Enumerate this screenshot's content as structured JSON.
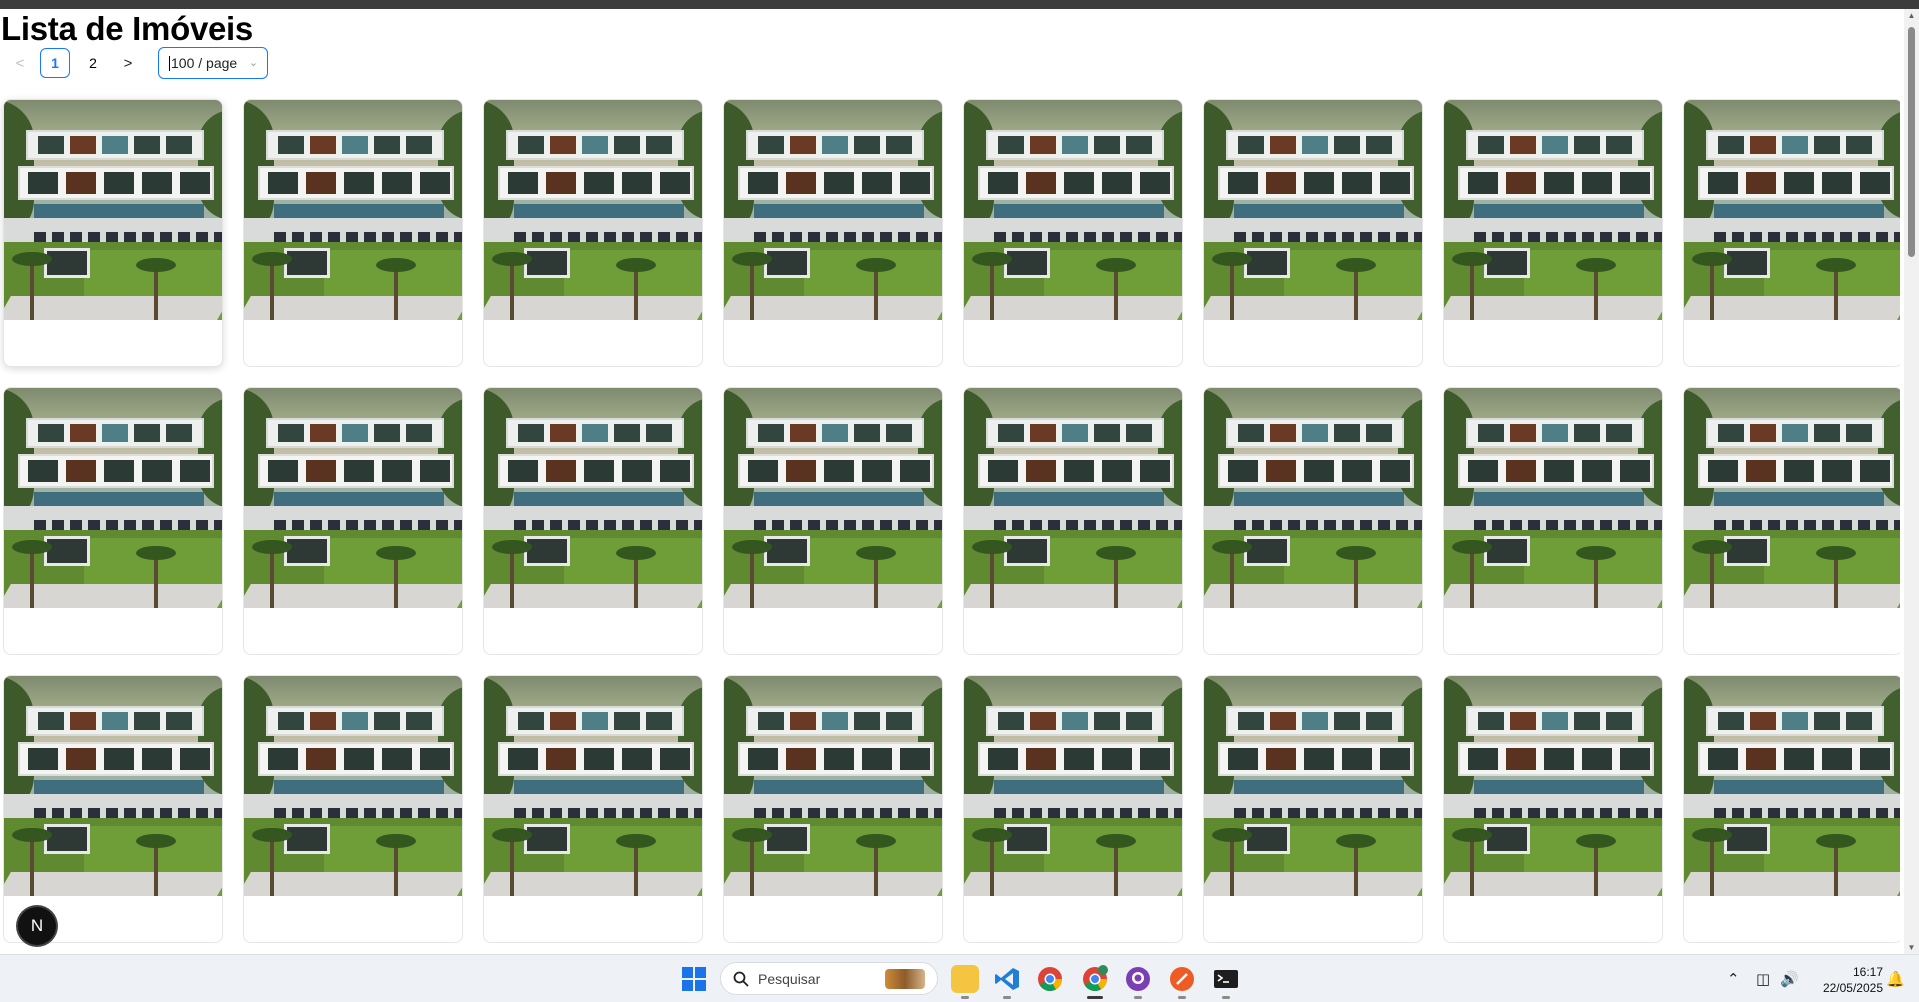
{
  "page": {
    "title": "Lista de Imóveis"
  },
  "pagination": {
    "prev_icon": "chevron-left-icon",
    "next_icon": "chevron-right-icon",
    "prev_label": "<",
    "next_label": ">",
    "pages": [
      "1",
      "2"
    ],
    "current_page": "1",
    "page_size": "100 / page"
  },
  "grid": {
    "rows_visible": 3,
    "columns": 8,
    "card_image": "luxury-house-photo",
    "cards": [
      {
        "id": 1
      },
      {
        "id": 2
      },
      {
        "id": 3
      },
      {
        "id": 4
      },
      {
        "id": 5
      },
      {
        "id": 6
      },
      {
        "id": 7
      },
      {
        "id": 8
      },
      {
        "id": 9
      },
      {
        "id": 10
      },
      {
        "id": 11
      },
      {
        "id": 12
      },
      {
        "id": 13
      },
      {
        "id": 14
      },
      {
        "id": 15
      },
      {
        "id": 16
      },
      {
        "id": 17
      },
      {
        "id": 18
      },
      {
        "id": 19
      },
      {
        "id": 20
      },
      {
        "id": 21
      },
      {
        "id": 22
      },
      {
        "id": 23
      },
      {
        "id": 24
      }
    ]
  },
  "fab": {
    "label": "N"
  },
  "taskbar": {
    "search_placeholder": "Pesquisar",
    "apps": [
      "file-explorer-icon",
      "vscode-icon",
      "chrome-icon",
      "chrome-profile-icon",
      "github-desktop-icon",
      "postman-icon",
      "terminal-icon"
    ],
    "time": "16:17",
    "date": "22/05/2025"
  },
  "colors": {
    "accent": "#1677ff",
    "taskbar_bg": "#eef1f6"
  }
}
